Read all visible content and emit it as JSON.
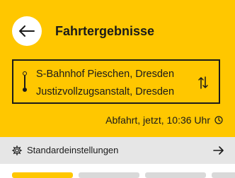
{
  "colors": {
    "accent": "#FFC700",
    "settings_bg": "#e6e6e6",
    "text": "#1a1a1a"
  },
  "header": {
    "back_icon": "arrow-left-icon",
    "title": "Fahrtergebnisse"
  },
  "route": {
    "from": "S-Bahnhof Pieschen, Dresden",
    "to": "Justizvollzugsanstalt, Dresden",
    "swap_icon": "swap-vertical-icon"
  },
  "departure": {
    "text": "Abfahrt, jetzt, 10:36 Uhr",
    "icon": "clock-icon"
  },
  "settings": {
    "icon": "gear-icon",
    "label": "Standardeinstellungen",
    "arrow_icon": "arrow-right-icon"
  }
}
